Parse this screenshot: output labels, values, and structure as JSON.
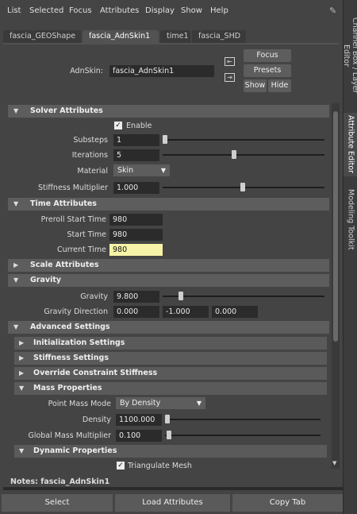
{
  "menu": [
    "List",
    "Selected",
    "Focus",
    "Attributes",
    "Display",
    "Show",
    "Help"
  ],
  "side_tabs": [
    "Channel Box / Layer Editor",
    "Attribute Editor",
    "Modeling Toolkit"
  ],
  "tabs": [
    "fascia_GEOShape",
    "fascia_AdnSkin1",
    "time1",
    "fascia_SHD"
  ],
  "node": {
    "label": "AdnSkin:",
    "value": "fascia_AdnSkin1"
  },
  "buttons": {
    "focus": "Focus",
    "presets": "Presets",
    "show": "Show",
    "hide": "Hide"
  },
  "solver": {
    "title": "Solver Attributes",
    "enable_label": "Enable",
    "substeps_label": "Substeps",
    "substeps": "1",
    "iterations_label": "Iterations",
    "iterations": "5",
    "material_label": "Material",
    "material": "Skin",
    "stiffness_label": "Stiffness Multiplier",
    "stiffness": "1.000"
  },
  "time": {
    "title": "Time Attributes",
    "preroll_label": "Preroll Start Time",
    "preroll": "980",
    "start_label": "Start Time",
    "start": "980",
    "current_label": "Current Time",
    "current": "980"
  },
  "scale": {
    "title": "Scale Attributes"
  },
  "gravity": {
    "title": "Gravity",
    "gravity_label": "Gravity",
    "gravity": "9.800",
    "direction_label": "Gravity Direction",
    "dir_x": "0.000",
    "dir_y": "-1.000",
    "dir_z": "0.000"
  },
  "advanced": {
    "title": "Advanced Settings",
    "init": "Initialization Settings",
    "stiff": "Stiffness Settings",
    "override": "Override Constraint Stiffness",
    "mass": "Mass Properties",
    "pmm_label": "Point Mass Mode",
    "pmm": "By Density",
    "density_label": "Density",
    "density": "1100.000",
    "gmm_label": "Global Mass Multiplier",
    "gmm": "0.100",
    "dynamic": "Dynamic Properties",
    "triangulate": "Triangulate Mesh"
  },
  "notes": "Notes:  fascia_AdnSkin1",
  "bottom": {
    "select": "Select",
    "load": "Load Attributes",
    "copy": "Copy Tab"
  }
}
